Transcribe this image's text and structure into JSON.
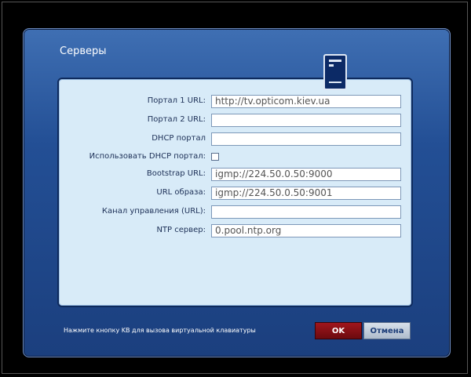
{
  "window": {
    "title": "Серверы",
    "hint": "Нажмите кнопку KB для вызова виртуальной клавиатуры"
  },
  "form": {
    "portal1": {
      "label": "Портал 1 URL:",
      "value": "http://tv.opticom.kiev.ua"
    },
    "portal2": {
      "label": "Портал 2 URL:",
      "value": ""
    },
    "dhcp_portal": {
      "label": "DHCP портал",
      "value": ""
    },
    "use_dhcp": {
      "label": "Использовать DHCP портал:",
      "checked": false
    },
    "bootstrap": {
      "label": "Bootstrap URL:",
      "value": "igmp://224.50.0.50:9000"
    },
    "image_url": {
      "label": "URL образа:",
      "value": "igmp://224.50.0.50:9001"
    },
    "control_channel": {
      "label": "Канал управления (URL):",
      "value": ""
    },
    "ntp": {
      "label": "NTP сервер:",
      "value": "0.pool.ntp.org"
    }
  },
  "buttons": {
    "ok_label": "OK",
    "cancel_label": "Отмена"
  },
  "icons": {
    "server": "server-tower-icon"
  }
}
